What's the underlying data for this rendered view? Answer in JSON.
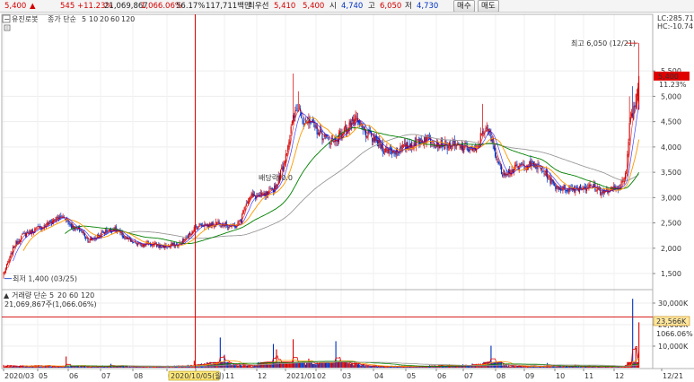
{
  "header": {
    "price": "5,400",
    "change": "545",
    "change_pct": "+11.23%",
    "volume": "21,069,867",
    "volume_ratio": "1,066.06%",
    "turnover": "56.17%",
    "amount": "117,711백만",
    "best_label": "최우선",
    "best_ask": "5,410",
    "best_bid": "5,400",
    "open_label": "시",
    "open": "4,740",
    "high_label": "고",
    "high": "6,050",
    "low_label": "저",
    "low": "4,730",
    "buy_label": "매수",
    "sell_label": "매도"
  },
  "colors": {
    "up": "#d40000",
    "down": "#0030c0",
    "ma5": "#e00000",
    "ma10": "#0000ff",
    "ma20": "#ff9900",
    "ma60": "#008000",
    "ma120": "#999999"
  },
  "chart_data": {
    "type": "candlestick",
    "stock_name": "유진로봇",
    "price_legend": {
      "label": "종가 단순",
      "periods": [
        "5",
        "10",
        "20",
        "60",
        "120"
      ]
    },
    "volume_legend": {
      "label": "거래량 단순",
      "periods": [
        "5",
        "20",
        "60",
        "120"
      ],
      "current": "21,069,867주(1,066.06%)"
    },
    "price_axis": {
      "ticks": [
        1500,
        2000,
        2500,
        3000,
        3500,
        4000,
        4500,
        5000,
        5500
      ],
      "tick_labels": [
        "1,500",
        "2,000",
        "2,500",
        "3,000",
        "3,500",
        "4,000",
        "4,500",
        "5,000",
        "5,500"
      ],
      "range": [
        1200,
        6300
      ]
    },
    "volume_axis": {
      "ticks": [
        10000,
        20000,
        30000
      ],
      "tick_labels": [
        "10,000K",
        "20,000K",
        "30,000K"
      ],
      "range": [
        0,
        35000
      ]
    },
    "right_labels": {
      "lc": "LC:285.71",
      "hc": "HC:-10.74",
      "price_box": "5,400",
      "price_pct": "11.23%",
      "volume_box": "23,566K",
      "volume_pct": "1066.06%"
    },
    "annotations": {
      "high": "최고 6,050 (12/21)",
      "low": "최저 1,400 (03/25)",
      "ex_rights": "배당락(0.0"
    },
    "cursor_date": "2020/10/05(월)",
    "x_labels": [
      "2020/03",
      "05",
      "06",
      "07",
      "08",
      "09",
      "10",
      "11",
      "12",
      "2021/01",
      "02",
      "03",
      "04",
      "05",
      "06",
      "07",
      "08",
      "09",
      "10",
      "11",
      "12",
      "12/21"
    ],
    "close_keypoints": [
      [
        0,
        1500
      ],
      [
        5,
        1750
      ],
      [
        10,
        2050
      ],
      [
        18,
        2250
      ],
      [
        28,
        2350
      ],
      [
        40,
        2450
      ],
      [
        50,
        2580
      ],
      [
        58,
        2630
      ],
      [
        66,
        2420
      ],
      [
        74,
        2350
      ],
      [
        82,
        2150
      ],
      [
        90,
        2230
      ],
      [
        98,
        2330
      ],
      [
        106,
        2380
      ],
      [
        114,
        2250
      ],
      [
        122,
        2130
      ],
      [
        130,
        2070
      ],
      [
        138,
        2100
      ],
      [
        146,
        2060
      ],
      [
        152,
        2030
      ],
      [
        160,
        2050
      ],
      [
        168,
        2070
      ],
      [
        176,
        2200
      ],
      [
        182,
        2380
      ],
      [
        190,
        2480
      ],
      [
        198,
        2450
      ],
      [
        206,
        2520
      ],
      [
        214,
        2460
      ],
      [
        222,
        2420
      ],
      [
        228,
        2560
      ],
      [
        232,
        2880
      ],
      [
        238,
        3030
      ],
      [
        246,
        3020
      ],
      [
        254,
        3060
      ],
      [
        262,
        3250
      ],
      [
        268,
        3600
      ],
      [
        272,
        3950
      ],
      [
        278,
        4550
      ],
      [
        283,
        4800
      ],
      [
        288,
        4550
      ],
      [
        294,
        4470
      ],
      [
        300,
        4350
      ],
      [
        308,
        4200
      ],
      [
        316,
        4100
      ],
      [
        324,
        4250
      ],
      [
        332,
        4450
      ],
      [
        338,
        4530
      ],
      [
        346,
        4300
      ],
      [
        356,
        4130
      ],
      [
        366,
        3950
      ],
      [
        376,
        3920
      ],
      [
        386,
        4000
      ],
      [
        396,
        4100
      ],
      [
        406,
        4180
      ],
      [
        416,
        4080
      ],
      [
        426,
        4030
      ],
      [
        436,
        4010
      ],
      [
        446,
        3980
      ],
      [
        454,
        3900
      ],
      [
        460,
        4350
      ],
      [
        466,
        4300
      ],
      [
        472,
        3900
      ],
      [
        478,
        3500
      ],
      [
        486,
        3520
      ],
      [
        496,
        3620
      ],
      [
        506,
        3650
      ],
      [
        514,
        3600
      ],
      [
        522,
        3450
      ],
      [
        528,
        3250
      ],
      [
        536,
        3180
      ],
      [
        546,
        3180
      ],
      [
        556,
        3200
      ],
      [
        566,
        3220
      ],
      [
        576,
        3100
      ],
      [
        584,
        3150
      ],
      [
        590,
        3200
      ],
      [
        594,
        3300
      ],
      [
        598,
        3450
      ],
      [
        601,
        4500
      ],
      [
        604,
        4700
      ],
      [
        607,
        4860
      ],
      [
        610,
        5400
      ]
    ],
    "volume_keypoints": [
      [
        0,
        1200
      ],
      [
        20,
        900
      ],
      [
        40,
        1100
      ],
      [
        60,
        800
      ],
      [
        100,
        900
      ],
      [
        150,
        700
      ],
      [
        180,
        1200
      ],
      [
        205,
        2800
      ],
      [
        208,
        14000
      ],
      [
        214,
        2500
      ],
      [
        230,
        1800
      ],
      [
        240,
        900
      ],
      [
        262,
        8500
      ],
      [
        278,
        13000
      ],
      [
        285,
        3000
      ],
      [
        300,
        2200
      ],
      [
        320,
        12000
      ],
      [
        330,
        3000
      ],
      [
        350,
        1000
      ],
      [
        400,
        800
      ],
      [
        460,
        2000
      ],
      [
        470,
        9000
      ],
      [
        480,
        1500
      ],
      [
        500,
        800
      ],
      [
        540,
        900
      ],
      [
        580,
        600
      ],
      [
        596,
        900
      ],
      [
        601,
        6000
      ],
      [
        604,
        32000
      ],
      [
        607,
        12000
      ],
      [
        610,
        21070
      ]
    ],
    "volume_spikes": [
      [
        60,
        5200
      ],
      [
        103,
        1800
      ],
      [
        183,
        3200
      ],
      [
        208,
        14000
      ],
      [
        212,
        6000
      ],
      [
        259,
        11000
      ],
      [
        262,
        8500
      ],
      [
        278,
        13200
      ],
      [
        293,
        4200
      ],
      [
        319,
        12300
      ],
      [
        323,
        3600
      ],
      [
        468,
        10200
      ],
      [
        522,
        2200
      ],
      [
        549,
        1500
      ],
      [
        604,
        32000
      ],
      [
        607,
        9300
      ],
      [
        610,
        21070
      ]
    ],
    "volume_threshold": 23566
  }
}
